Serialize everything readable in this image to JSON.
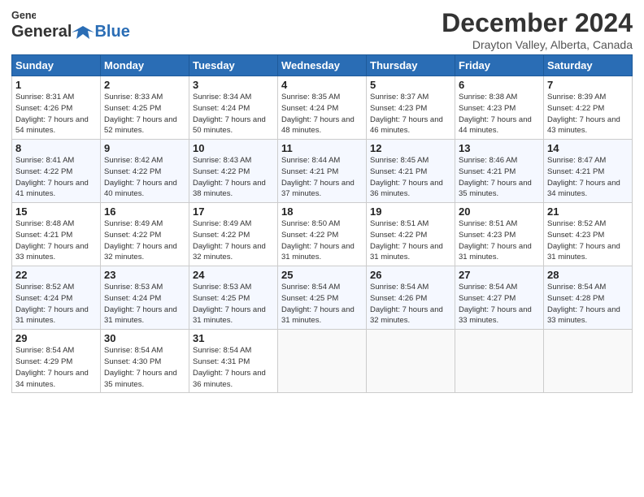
{
  "header": {
    "logo_general": "General",
    "logo_blue": "Blue",
    "title": "December 2024",
    "location": "Drayton Valley, Alberta, Canada"
  },
  "days_of_week": [
    "Sunday",
    "Monday",
    "Tuesday",
    "Wednesday",
    "Thursday",
    "Friday",
    "Saturday"
  ],
  "weeks": [
    [
      {
        "day": "1",
        "sunrise": "8:31 AM",
        "sunset": "4:26 PM",
        "daylight": "7 hours and 54 minutes."
      },
      {
        "day": "2",
        "sunrise": "8:33 AM",
        "sunset": "4:25 PM",
        "daylight": "7 hours and 52 minutes."
      },
      {
        "day": "3",
        "sunrise": "8:34 AM",
        "sunset": "4:24 PM",
        "daylight": "7 hours and 50 minutes."
      },
      {
        "day": "4",
        "sunrise": "8:35 AM",
        "sunset": "4:24 PM",
        "daylight": "7 hours and 48 minutes."
      },
      {
        "day": "5",
        "sunrise": "8:37 AM",
        "sunset": "4:23 PM",
        "daylight": "7 hours and 46 minutes."
      },
      {
        "day": "6",
        "sunrise": "8:38 AM",
        "sunset": "4:23 PM",
        "daylight": "7 hours and 44 minutes."
      },
      {
        "day": "7",
        "sunrise": "8:39 AM",
        "sunset": "4:22 PM",
        "daylight": "7 hours and 43 minutes."
      }
    ],
    [
      {
        "day": "8",
        "sunrise": "8:41 AM",
        "sunset": "4:22 PM",
        "daylight": "7 hours and 41 minutes."
      },
      {
        "day": "9",
        "sunrise": "8:42 AM",
        "sunset": "4:22 PM",
        "daylight": "7 hours and 40 minutes."
      },
      {
        "day": "10",
        "sunrise": "8:43 AM",
        "sunset": "4:22 PM",
        "daylight": "7 hours and 38 minutes."
      },
      {
        "day": "11",
        "sunrise": "8:44 AM",
        "sunset": "4:21 PM",
        "daylight": "7 hours and 37 minutes."
      },
      {
        "day": "12",
        "sunrise": "8:45 AM",
        "sunset": "4:21 PM",
        "daylight": "7 hours and 36 minutes."
      },
      {
        "day": "13",
        "sunrise": "8:46 AM",
        "sunset": "4:21 PM",
        "daylight": "7 hours and 35 minutes."
      },
      {
        "day": "14",
        "sunrise": "8:47 AM",
        "sunset": "4:21 PM",
        "daylight": "7 hours and 34 minutes."
      }
    ],
    [
      {
        "day": "15",
        "sunrise": "8:48 AM",
        "sunset": "4:21 PM",
        "daylight": "7 hours and 33 minutes."
      },
      {
        "day": "16",
        "sunrise": "8:49 AM",
        "sunset": "4:22 PM",
        "daylight": "7 hours and 32 minutes."
      },
      {
        "day": "17",
        "sunrise": "8:49 AM",
        "sunset": "4:22 PM",
        "daylight": "7 hours and 32 minutes."
      },
      {
        "day": "18",
        "sunrise": "8:50 AM",
        "sunset": "4:22 PM",
        "daylight": "7 hours and 31 minutes."
      },
      {
        "day": "19",
        "sunrise": "8:51 AM",
        "sunset": "4:22 PM",
        "daylight": "7 hours and 31 minutes."
      },
      {
        "day": "20",
        "sunrise": "8:51 AM",
        "sunset": "4:23 PM",
        "daylight": "7 hours and 31 minutes."
      },
      {
        "day": "21",
        "sunrise": "8:52 AM",
        "sunset": "4:23 PM",
        "daylight": "7 hours and 31 minutes."
      }
    ],
    [
      {
        "day": "22",
        "sunrise": "8:52 AM",
        "sunset": "4:24 PM",
        "daylight": "7 hours and 31 minutes."
      },
      {
        "day": "23",
        "sunrise": "8:53 AM",
        "sunset": "4:24 PM",
        "daylight": "7 hours and 31 minutes."
      },
      {
        "day": "24",
        "sunrise": "8:53 AM",
        "sunset": "4:25 PM",
        "daylight": "7 hours and 31 minutes."
      },
      {
        "day": "25",
        "sunrise": "8:54 AM",
        "sunset": "4:25 PM",
        "daylight": "7 hours and 31 minutes."
      },
      {
        "day": "26",
        "sunrise": "8:54 AM",
        "sunset": "4:26 PM",
        "daylight": "7 hours and 32 minutes."
      },
      {
        "day": "27",
        "sunrise": "8:54 AM",
        "sunset": "4:27 PM",
        "daylight": "7 hours and 33 minutes."
      },
      {
        "day": "28",
        "sunrise": "8:54 AM",
        "sunset": "4:28 PM",
        "daylight": "7 hours and 33 minutes."
      }
    ],
    [
      {
        "day": "29",
        "sunrise": "8:54 AM",
        "sunset": "4:29 PM",
        "daylight": "7 hours and 34 minutes."
      },
      {
        "day": "30",
        "sunrise": "8:54 AM",
        "sunset": "4:30 PM",
        "daylight": "7 hours and 35 minutes."
      },
      {
        "day": "31",
        "sunrise": "8:54 AM",
        "sunset": "4:31 PM",
        "daylight": "7 hours and 36 minutes."
      },
      null,
      null,
      null,
      null
    ]
  ],
  "labels": {
    "sunrise": "Sunrise:",
    "sunset": "Sunset:",
    "daylight": "Daylight:"
  }
}
